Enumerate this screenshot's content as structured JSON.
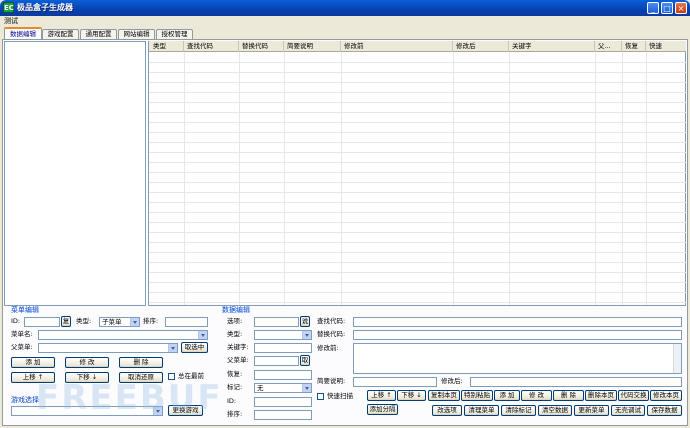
{
  "window": {
    "title": "极品盒子生成器",
    "app_icon": "EC"
  },
  "menu": {
    "items": [
      "测试"
    ]
  },
  "tabs": [
    "数据编辑",
    "游戏配置",
    "通用配置",
    "网站编辑",
    "授权管理"
  ],
  "grid": {
    "columns": [
      "类型",
      "查找代码",
      "替换代码",
      "简要说明",
      "修改前",
      "修改后",
      "关键字",
      "父...",
      "恢复",
      "快速"
    ]
  },
  "menu_edit": {
    "title": "菜单编辑",
    "id_label": "ID:",
    "copy_button": "复",
    "type_label": "类型:",
    "type_value": "子菜单",
    "sort_label": "排序:",
    "name_label": "菜单名:",
    "parent_label": "父菜单:",
    "cancel_select": "取选中",
    "add": "添 加",
    "modify": "修 改",
    "delete": "删 除",
    "move_up": "上移 ↑",
    "move_down": "下移 ↓",
    "cancel_restore": "取消还原",
    "always_top": "总在最前"
  },
  "game_select": {
    "title": "游戏选择",
    "switch_button": "更换游戏"
  },
  "data_edit": {
    "title": "数据编辑",
    "option_label": "选项:",
    "option_btn": "说",
    "type_label": "类型:",
    "keyword_label": "关键字:",
    "parent_label": "父菜单:",
    "parent_btn": "取",
    "restore_label": "恢复:",
    "mark_label": "标记:",
    "mark_value": "无",
    "id_label": "ID:",
    "sort_label": "排序:",
    "find_label": "查找代码:",
    "replace_label": "替换代码:",
    "before_label": "修改前:",
    "desc_label": "简要说明:",
    "after_label": "修改后:",
    "quick_scan": "快速扫描",
    "buttons_row1": [
      "上移 ↑",
      "下移 ↓",
      "复制本页",
      "特别粘贴",
      "添 加",
      "修 改",
      "删 除",
      "删除本页",
      "代码交换",
      "修改本页"
    ],
    "add_category": "添加分隔",
    "buttons_row2": [
      "改选项",
      "清理菜单",
      "清除标记",
      "清空数据",
      "更新菜单",
      "无壳调试",
      "保存数据"
    ]
  },
  "watermark": "FREEBUF"
}
